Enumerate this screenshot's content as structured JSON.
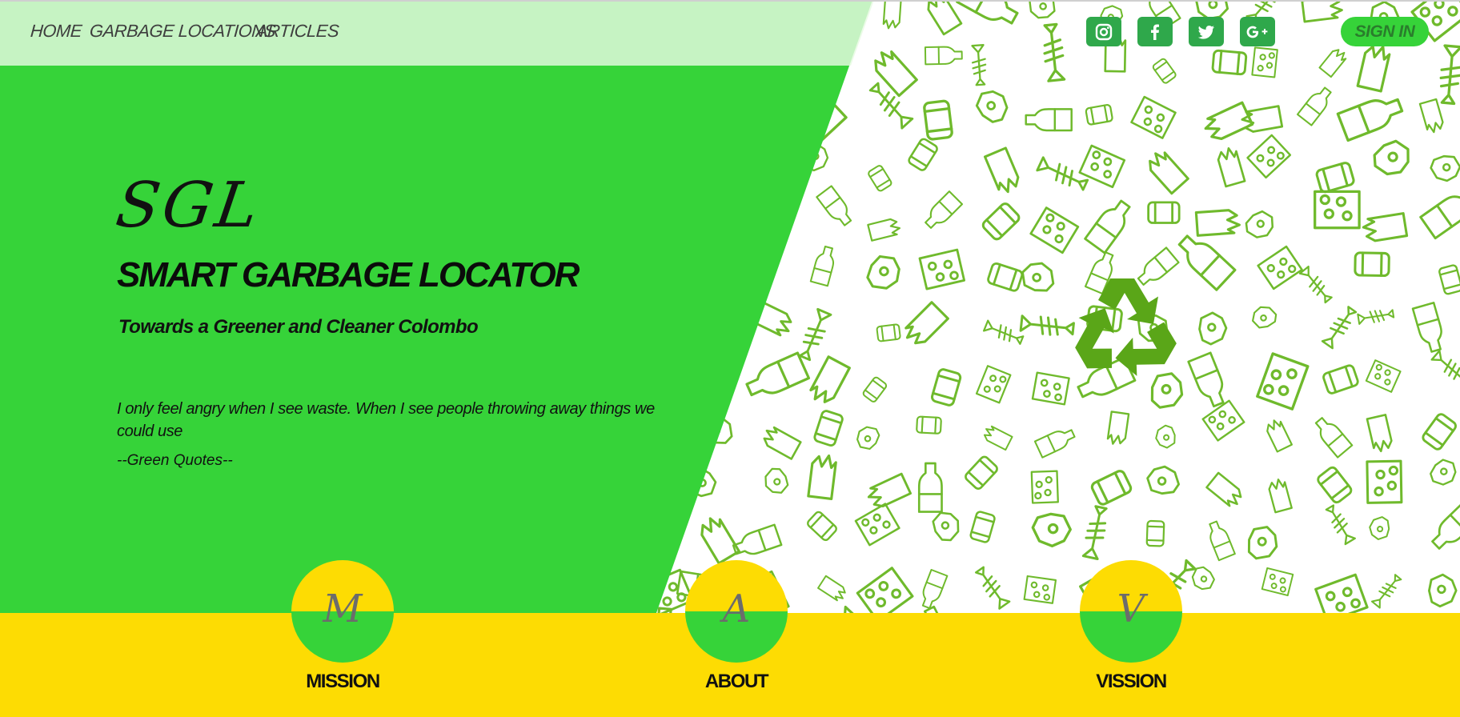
{
  "nav": {
    "links": [
      {
        "label": "HOME"
      },
      {
        "label": "GARBAGE LOCATIONS"
      },
      {
        "label": "ARTICLES"
      }
    ]
  },
  "social": [
    {
      "icon": "instagram-icon"
    },
    {
      "icon": "facebook-icon"
    },
    {
      "icon": "twitter-icon"
    },
    {
      "icon": "google-plus-icon"
    }
  ],
  "sign_in": {
    "label": "SIGN IN"
  },
  "hero": {
    "brand_short": "SGL",
    "brand_long": "SMART GARBAGE LOCATOR",
    "tagline": "Towards a Greener and Cleaner Colombo",
    "quote": "I only feel angry when I see waste. When I see people throwing away things we could use",
    "quote_source": "--Green Quotes--"
  },
  "sections": [
    {
      "letter": "M",
      "label": "MISSION"
    },
    {
      "letter": "A",
      "label": "ABOUT"
    },
    {
      "letter": "V",
      "label": "VISSION"
    }
  ],
  "colors": {
    "hero_green": "#36d339",
    "footer_yellow": "#fddc03",
    "social_green": "#2fa84b",
    "doodle_green": "#6fba2c",
    "recycle_green": "#5aa618"
  }
}
